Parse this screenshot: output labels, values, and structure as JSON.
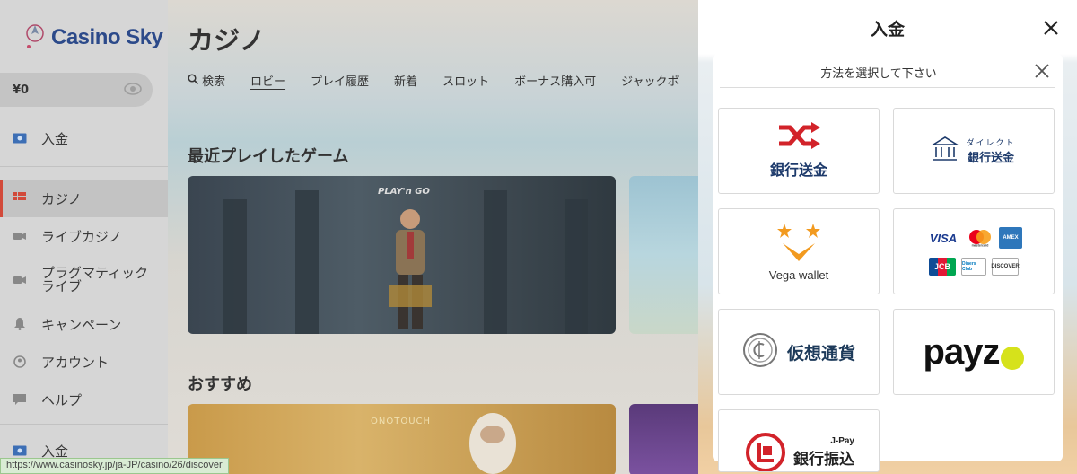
{
  "brand": {
    "name": "Casino Sky"
  },
  "balance": {
    "amount": "¥0"
  },
  "nav": {
    "items": [
      {
        "label": "入金",
        "icon": "deposit-icon"
      },
      {
        "label": "カジノ",
        "icon": "grid-icon",
        "active": true
      },
      {
        "label": "ライブカジノ",
        "icon": "camera-icon"
      },
      {
        "label": "プラグマティック\nライブ",
        "icon": "camera-icon"
      },
      {
        "label": "キャンペーン",
        "icon": "bell-icon"
      },
      {
        "label": "アカウント",
        "icon": "account-icon"
      },
      {
        "label": "ヘルプ",
        "icon": "chat-icon"
      },
      {
        "label": "入金",
        "icon": "deposit-icon"
      }
    ]
  },
  "status_url": "https://www.casinosky.jp/ja-JP/casino/26/discover",
  "main": {
    "title": "カジノ",
    "tabs": [
      {
        "label": "検索",
        "icon": "search-icon"
      },
      {
        "label": "ロビー",
        "active": true
      },
      {
        "label": "プレイ履歴"
      },
      {
        "label": "新着"
      },
      {
        "label": "スロット"
      },
      {
        "label": "ボーナス購入可"
      },
      {
        "label": "ジャックポ"
      }
    ],
    "recent_title": "最近プレイしたゲーム",
    "recommended_title": "おすすめ",
    "game_brand": "PLAY'n GO",
    "game2_brand": "ONOTOUCH"
  },
  "panel": {
    "title": "入金",
    "subtitle": "方法を選択して下さい",
    "methods": [
      {
        "id": "bank-transfer",
        "label": "銀行送金",
        "icon": "shuffle-icon",
        "accent": "#d2232a"
      },
      {
        "id": "direct-bank",
        "label_small": "ダイレクト",
        "label": "銀行送金",
        "icon": "bank-icon",
        "accent": "#1d3a6b"
      },
      {
        "id": "vega-wallet",
        "label": "Vega wallet",
        "icon": "vega-stars-icon",
        "accent": "#f29a1f"
      },
      {
        "id": "credit-cards",
        "cards": [
          "VISA",
          "mastercard",
          "AMEX",
          "JCB",
          "Diners Club",
          "DISCOVER"
        ]
      },
      {
        "id": "crypto",
        "label": "仮想通貨",
        "icon": "crypto-coin-icon"
      },
      {
        "id": "payz",
        "label": "payz",
        "accent": "#d6e21b"
      },
      {
        "id": "jpay",
        "label_small": "J-Pay",
        "label": "銀行振込",
        "icon": "jpay-icon",
        "accent": "#d2232a"
      }
    ]
  }
}
